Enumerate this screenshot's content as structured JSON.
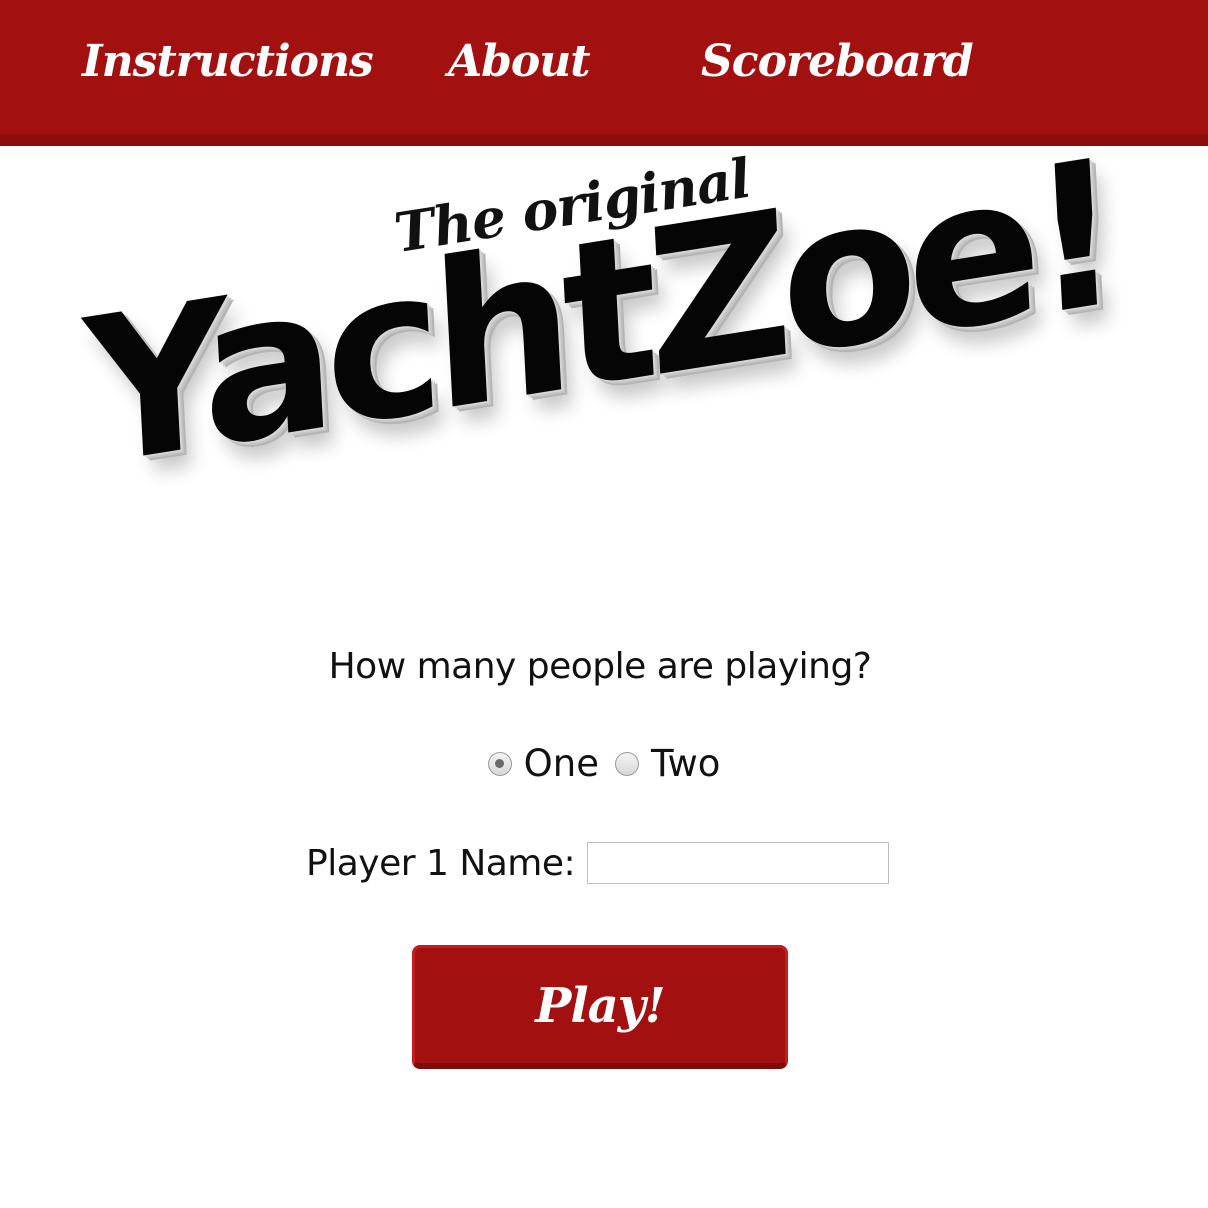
{
  "nav": {
    "instructions": "Instructions",
    "about": "About",
    "scoreboard": "Scoreboard"
  },
  "logo": {
    "tagline": "The original",
    "wordmark": "YachtZoe!"
  },
  "form": {
    "question": "How many people are playing?",
    "options": [
      "One",
      "Two"
    ],
    "selected_option": "One",
    "player_label": "Player 1 Name:",
    "player_value": "",
    "play_label": "Play!"
  },
  "colors": {
    "accent": "#a31010",
    "accent_dark": "#8c0d0d"
  }
}
